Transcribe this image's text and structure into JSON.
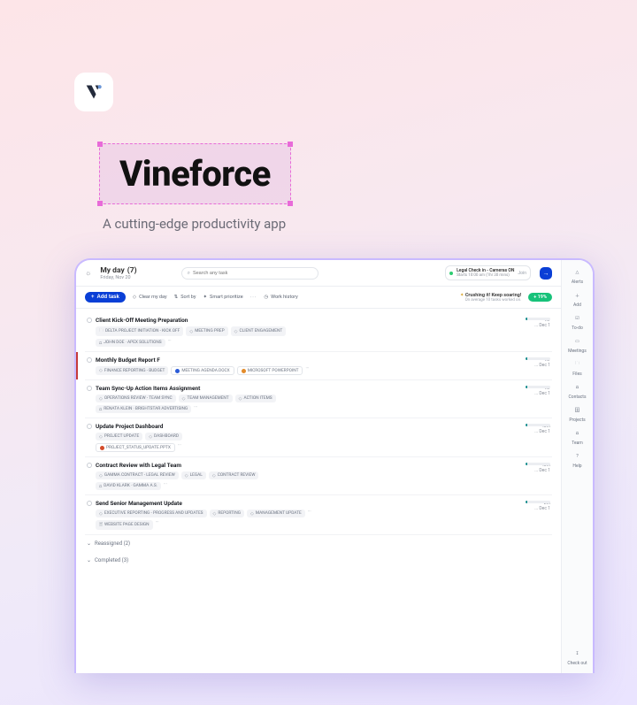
{
  "brand": {
    "title": "Vineforce",
    "subtitle": "A cutting-edge productivity app"
  },
  "header": {
    "day_title_prefix": "My day",
    "day_count": "(7)",
    "date": "Friday, Nov 20",
    "search_placeholder": "Search any task",
    "status_title": "Legal Check in - Cameras ON",
    "status_sub": "Starts 10:00 am (1hr 30 mins)",
    "status_join": "Join"
  },
  "toolbar": {
    "add": "Add task",
    "clear": "Clear my day",
    "sort": "Sort by",
    "smart": "Smart prioritize",
    "history": "Work history",
    "crush": "Crushing it! Keep soaring!",
    "crush_sub": "On average 10 tasks worked on.",
    "percent": "+ 19%"
  },
  "tasks": [
    {
      "title": "Client Kick-Off Meeting Preparation",
      "duration": "1hr",
      "due": "... Dec 1",
      "progress": 8,
      "tags": [
        "DELTA PROJECT INITIATION - KICK OFF",
        "MEETING PREP",
        "CLIENT ENGAGEMENT"
      ],
      "people": [
        "JOHN DOE · APEX SOLUTIONS"
      ],
      "files": []
    },
    {
      "title": "Monthly Budget Report F",
      "duration": "1hr",
      "due": "... Dec 1",
      "progress": 8,
      "active": true,
      "tags": [
        "FINANCE REPORTING - BUDGET"
      ],
      "people": [],
      "files": [
        {
          "color": "blue",
          "label": "MEETING AGENDA.DOCX"
        },
        {
          "color": "orange",
          "label": "MICROSOFT POWERPOINT"
        }
      ]
    },
    {
      "title": "Team Sync-Up Action Items Assignment",
      "duration": "1hr",
      "due": "... Dec 1",
      "progress": 8,
      "tags": [
        "OPERATIONS REVIEW - TEAM SYNC",
        "TEAM MANAGEMENT",
        "ACTION ITEMS"
      ],
      "people": [
        "RENATA KLEIN · BRIGHTSTAR ADVERTISING"
      ],
      "files": []
    },
    {
      "title": "Update Project Dashboard",
      "duration": "40m",
      "due": "... Dec 1",
      "progress": 8,
      "tags": [
        "PROJECT UPDATE",
        "DASHBOARD"
      ],
      "people": [],
      "files": [
        {
          "color": "red",
          "label": "PROJECT_STATUS_UPDATE.PPTX"
        }
      ]
    },
    {
      "title": "Contract Review with Legal Team",
      "duration": "40m",
      "due": "... Dec 1",
      "progress": 8,
      "tags": [
        "GAMMA CONTRACT - LEGAL REVIEW",
        "LEGAL",
        "CONTRACT REVIEW"
      ],
      "people": [
        "DAVID KLARK · GAMMA A.S."
      ],
      "files": []
    },
    {
      "title": "Send Senior Management Update",
      "duration": "2m",
      "due": "... Dec 1",
      "progress": 8,
      "tags": [
        "EXECUTIVE REPORTING - PROGRESS AND UPDATES",
        "REPORTING",
        "MANAGEMENT UPDATE"
      ],
      "people": [],
      "files": [],
      "extra_tags": [
        "WEBSITE PAGE DESIGN"
      ]
    }
  ],
  "sections": {
    "reassigned": "Reassigned (2)",
    "completed": "Completed (3)"
  },
  "sidebar": {
    "items": [
      "Alerts",
      "Add",
      "To-do",
      "Meetings",
      "Files",
      "Contacts",
      "Projects",
      "Team",
      "Help"
    ],
    "bottom": "Check out"
  },
  "icons": {
    "sun": "☼",
    "search": "⌕",
    "clear": "◇",
    "sort": "⇅",
    "spark": "✦",
    "clock": "◷",
    "plus": "+",
    "bell": "△",
    "add": "＋",
    "todo": "☑",
    "meet": "▭",
    "files": "🗀",
    "contacts": "⩍",
    "projects": "🗄",
    "team": "⩍",
    "help": "?",
    "checkout": "↧",
    "folder": "🗀",
    "tag": "◇",
    "person": "⩍",
    "file": "🗎"
  }
}
